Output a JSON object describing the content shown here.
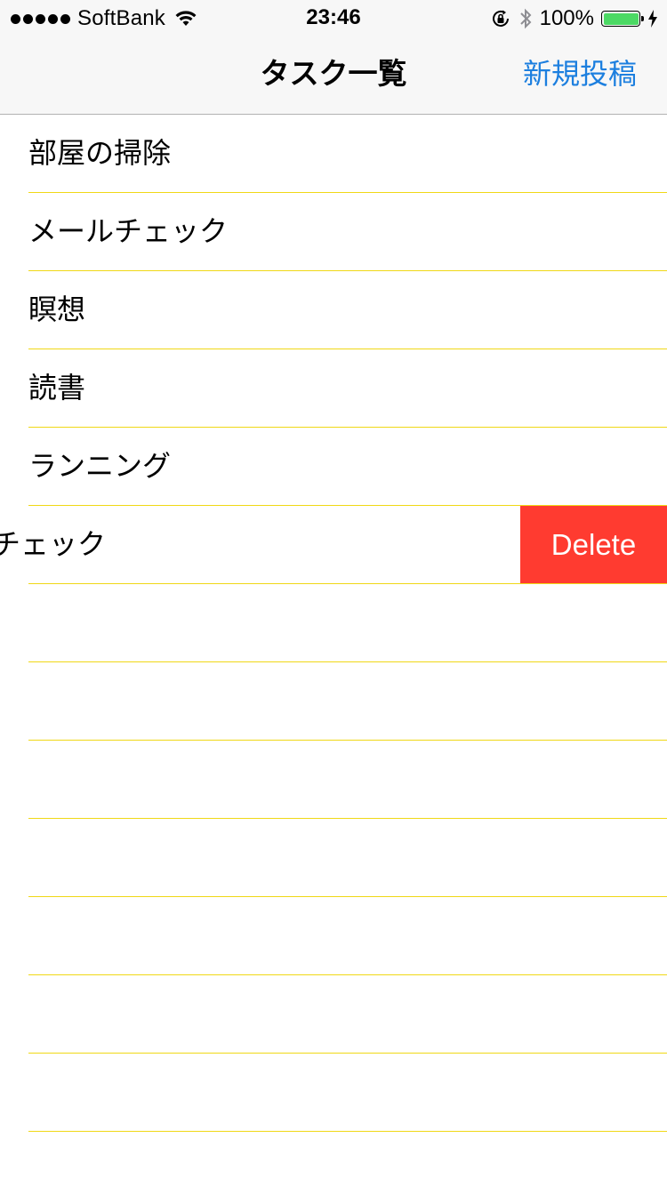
{
  "status_bar": {
    "carrier": "SoftBank",
    "time": "23:46",
    "battery_percent": "100%",
    "battery_level": 1.0,
    "icons": [
      "signal-dots-icon",
      "wifi-icon",
      "rotation-lock-icon",
      "bluetooth-icon",
      "battery-icon",
      "charging-bolt-icon"
    ]
  },
  "nav": {
    "title": "タスク一覧",
    "right_button": "新規投稿",
    "accent_color": "#1c7fdf"
  },
  "tasks": [
    {
      "label": "部屋の掃除"
    },
    {
      "label": "メールチェック"
    },
    {
      "label": "瞑想"
    },
    {
      "label": "読書"
    },
    {
      "label": "ランニング"
    },
    {
      "label": "チェック",
      "swiped": true
    }
  ],
  "swipe_action": {
    "delete_label": "Delete",
    "color": "#ff3b30"
  },
  "separator_color": "#f0d816"
}
